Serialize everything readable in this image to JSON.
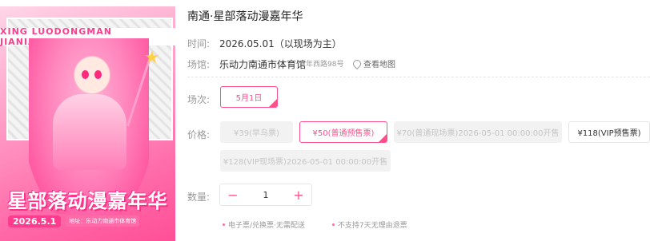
{
  "poster": {
    "band_text": "XING  LUODONGMAN JIANIANHUA",
    "title_zh": "星部落动漫嘉年华",
    "date_tag": "2026.5.1",
    "location_tag": "地址：乐动力南通市体育馆"
  },
  "event": {
    "title": "南通·星部落动漫嘉年华",
    "time_label": "时间:",
    "time_value": "2026.05.01（以现场为主）",
    "venue_label": "场馆:",
    "venue_name": "乐动力南通市体育馆",
    "venue_address": "青年西路98号",
    "map_link": "查看地图"
  },
  "session": {
    "label": "场次:",
    "options": [
      "5月1日"
    ]
  },
  "price": {
    "label": "价格:",
    "options": [
      "¥39(早鸟票)",
      "¥50(普通预售票)",
      "¥70(普通现场票)2026-05-01 00:00:00开售",
      "¥118(VIP预售票)",
      "¥128(VIP现场票)2026-05-01 00:00:00开售"
    ]
  },
  "quantity": {
    "label": "数量:",
    "value": "1",
    "minus": "−",
    "plus": "+"
  },
  "notes": [
    "电子票/兑换票·无需配送",
    "不支持7天无理由退票"
  ]
}
